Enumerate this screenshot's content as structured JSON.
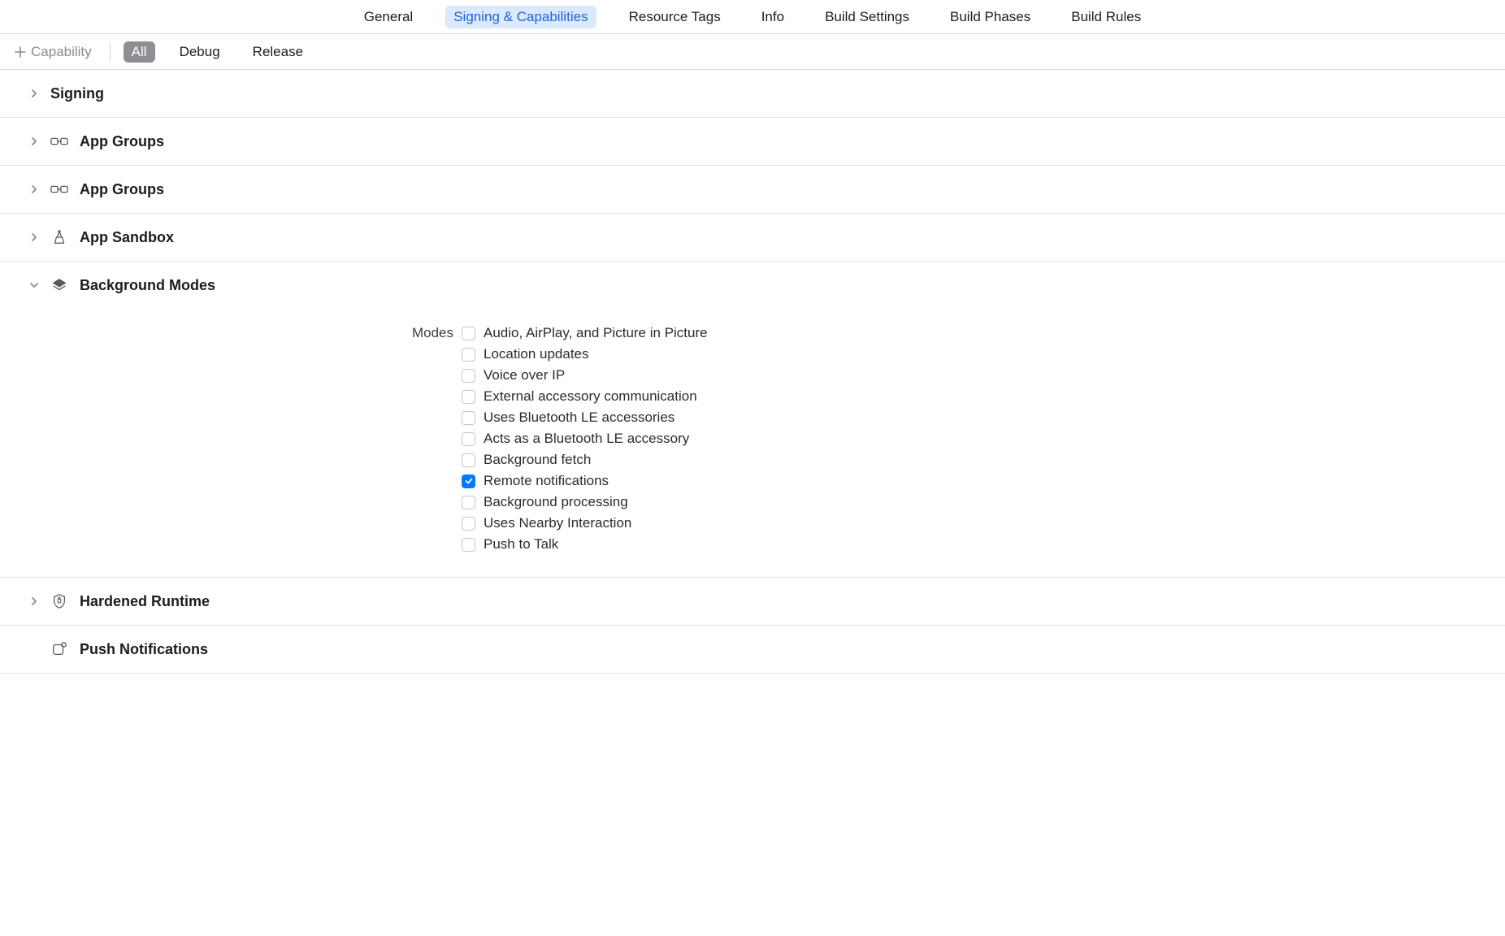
{
  "topTabs": {
    "items": [
      "General",
      "Signing & Capabilities",
      "Resource Tags",
      "Info",
      "Build Settings",
      "Build Phases",
      "Build Rules"
    ],
    "selectedIndex": 1
  },
  "toolbar": {
    "capabilityButton": "Capability",
    "configTabs": {
      "items": [
        "All",
        "Debug",
        "Release"
      ],
      "selectedIndex": 0
    }
  },
  "sections": [
    {
      "title": "Signing",
      "expanded": false,
      "icon": null
    },
    {
      "title": "App Groups",
      "expanded": false,
      "icon": "link"
    },
    {
      "title": "App Groups",
      "expanded": false,
      "icon": "link"
    },
    {
      "title": "App Sandbox",
      "expanded": false,
      "icon": "sandbox"
    },
    {
      "title": "Background Modes",
      "expanded": true,
      "icon": "layers",
      "modesLabel": "Modes",
      "modes": [
        {
          "label": "Audio, AirPlay, and Picture in Picture",
          "checked": false
        },
        {
          "label": "Location updates",
          "checked": false
        },
        {
          "label": "Voice over IP",
          "checked": false
        },
        {
          "label": "External accessory communication",
          "checked": false
        },
        {
          "label": "Uses Bluetooth LE accessories",
          "checked": false
        },
        {
          "label": "Acts as a Bluetooth LE accessory",
          "checked": false
        },
        {
          "label": "Background fetch",
          "checked": false
        },
        {
          "label": "Remote notifications",
          "checked": true
        },
        {
          "label": "Background processing",
          "checked": false
        },
        {
          "label": "Uses Nearby Interaction",
          "checked": false
        },
        {
          "label": "Push to Talk",
          "checked": false
        }
      ]
    },
    {
      "title": "Hardened Runtime",
      "expanded": false,
      "icon": "shield"
    },
    {
      "title": "Push Notifications",
      "expanded": false,
      "icon": "push",
      "noChevron": true
    }
  ],
  "colors": {
    "accent": "#007aff",
    "tabSelectedBg": "#daeafc",
    "tabSelectedText": "#1d63d6",
    "configSelectedBg": "#8e8e93"
  }
}
